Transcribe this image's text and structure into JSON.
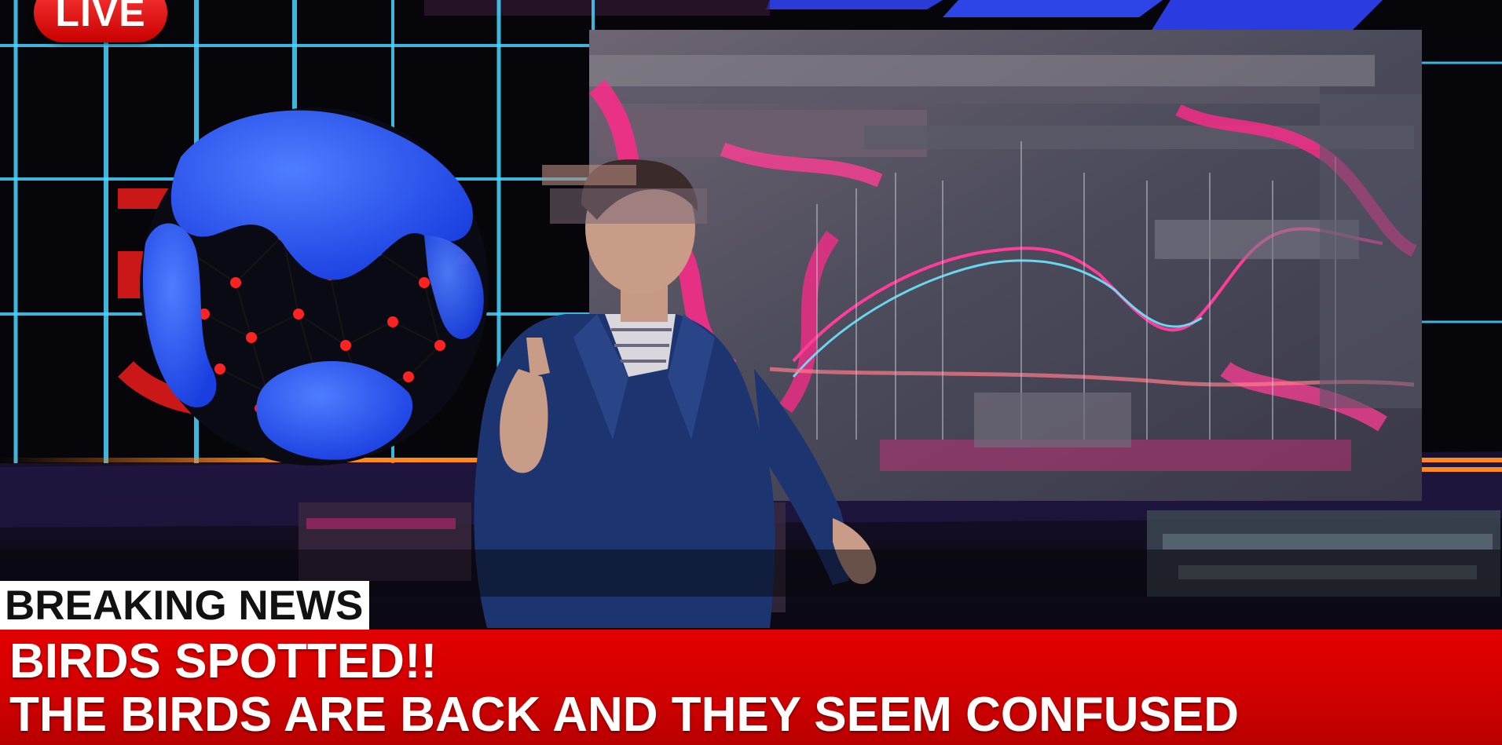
{
  "overlay": {
    "live_badge": "LIVE",
    "breaking_tag": "BREAKING NEWS",
    "headline": "BIRDS SPOTTED!!",
    "subheadline": "THE BIRDS ARE BACK AND THEY SEEM CONFUSED"
  },
  "colors": {
    "live_red": "#e01010",
    "ticker_red": "#d20000",
    "tag_white": "#ffffff",
    "globe_blue": "#2b5cff",
    "grid_cyan": "#3ad0ff",
    "glitch_magenta": "#ff2a8a"
  },
  "scene": {
    "description_elements": [
      "globe-graphic",
      "news-anchor-figure",
      "glitched-chart-screen",
      "studio-grid"
    ]
  }
}
